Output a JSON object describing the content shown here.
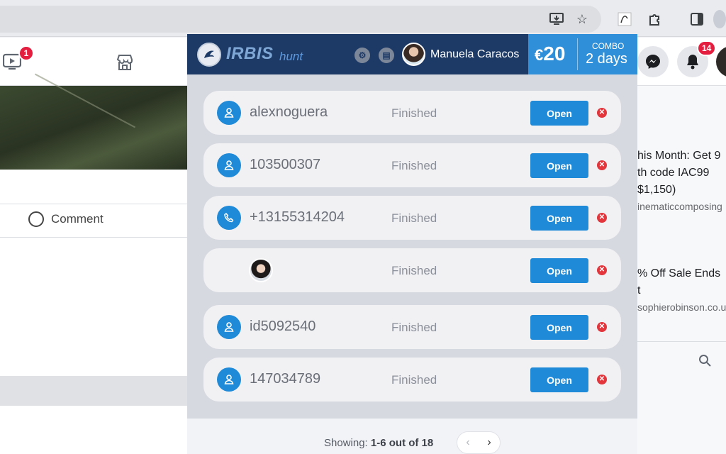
{
  "browser": {
    "star_glyph": "☆",
    "install_glyph": "⇩",
    "puzzle_glyph": "✦"
  },
  "facebook": {
    "watch_badge": "1",
    "notifications_badge": "14",
    "comment_label": "Comment",
    "ads": [
      {
        "line1": "his Month: Get 9",
        "line2": "th code IAC99",
        "line3": "$1,150)",
        "url": "inematiccomposing"
      },
      {
        "line1": "% Off Sale Ends",
        "line2": "t",
        "url": "sophierobinson.co.u"
      }
    ]
  },
  "extension": {
    "logo_main": "IRBIS",
    "logo_sub": "hunt",
    "user_name": "Manuela Caracos",
    "balance": "20",
    "currency": "€",
    "combo_label": "COMBO",
    "combo_days": "2 days",
    "open_label": "Open",
    "colors": {
      "header": "#1d3a66",
      "accent": "#1f8ad8",
      "danger": "#e2353c"
    },
    "results": [
      {
        "icon": "user-icon",
        "name": "alexnoguera",
        "status": "Finished"
      },
      {
        "icon": "user-icon",
        "name": "103500307",
        "status": "Finished"
      },
      {
        "icon": "phone-icon",
        "name": "+13155314204",
        "status": "Finished"
      },
      {
        "icon": "photo",
        "name": "",
        "status": "Finished"
      },
      {
        "icon": "user-icon",
        "name": "id5092540",
        "status": "Finished"
      },
      {
        "icon": "user-icon",
        "name": "147034789",
        "status": "Finished"
      }
    ],
    "pagination": {
      "prefix": "Showing:",
      "range": "1-6 out of 18",
      "prev": "‹",
      "next": "›"
    }
  }
}
